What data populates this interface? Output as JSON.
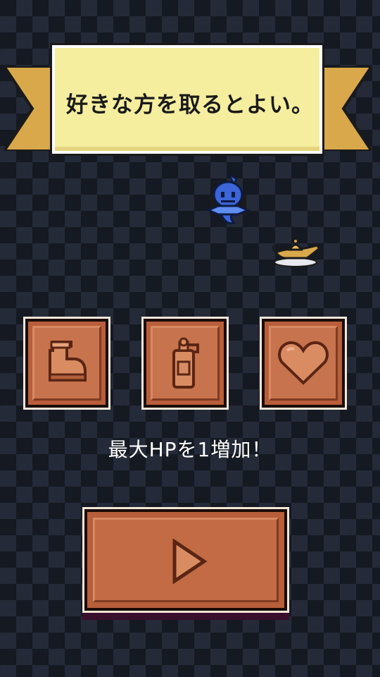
{
  "banner": {
    "text": "好きな方を取るとよい。"
  },
  "items": [
    {
      "id": "boot",
      "icon": "boot-icon"
    },
    {
      "id": "extinguisher",
      "icon": "fire-extinguisher-icon"
    },
    {
      "id": "heart",
      "icon": "heart-icon"
    }
  ],
  "selected_item": "heart",
  "description": "最大HPを1増加！",
  "play_button": {
    "icon": "play-triangle-icon"
  },
  "colors": {
    "background_dark": "#151922",
    "background_diamond": "#242a37",
    "banner_paper": "#f6ee9f",
    "ribbon_gold": "#d8a84a",
    "card_copper": "#c7734d",
    "card_border": "#1a0c08",
    "icon_fill": "#d98c62"
  }
}
